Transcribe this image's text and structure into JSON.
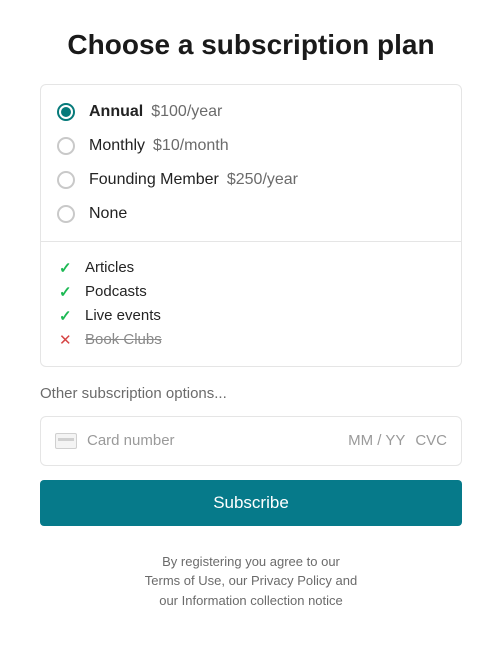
{
  "title": "Choose a subscription plan",
  "plans": [
    {
      "name": "Annual",
      "price": "$100/year",
      "selected": true
    },
    {
      "name": "Monthly",
      "price": "$10/month",
      "selected": false
    },
    {
      "name": "Founding Member",
      "price": "$250/year",
      "selected": false
    },
    {
      "name": "None",
      "price": "",
      "selected": false
    }
  ],
  "features": [
    {
      "label": "Articles",
      "included": true
    },
    {
      "label": "Podcasts",
      "included": true
    },
    {
      "label": "Live events",
      "included": true
    },
    {
      "label": "Book Clubs",
      "included": false
    }
  ],
  "other_options_label": "Other subscription options...",
  "card_input": {
    "number_placeholder": "Card number",
    "expiry_placeholder": "MM / YY",
    "cvc_placeholder": "CVC"
  },
  "subscribe_label": "Subscribe",
  "legal": {
    "line1": "By registering you agree to our",
    "line2": "Terms of Use, our Privacy Policy and",
    "line3": "our Information collection notice"
  },
  "icons": {
    "check": "✓",
    "cross": "✕"
  }
}
